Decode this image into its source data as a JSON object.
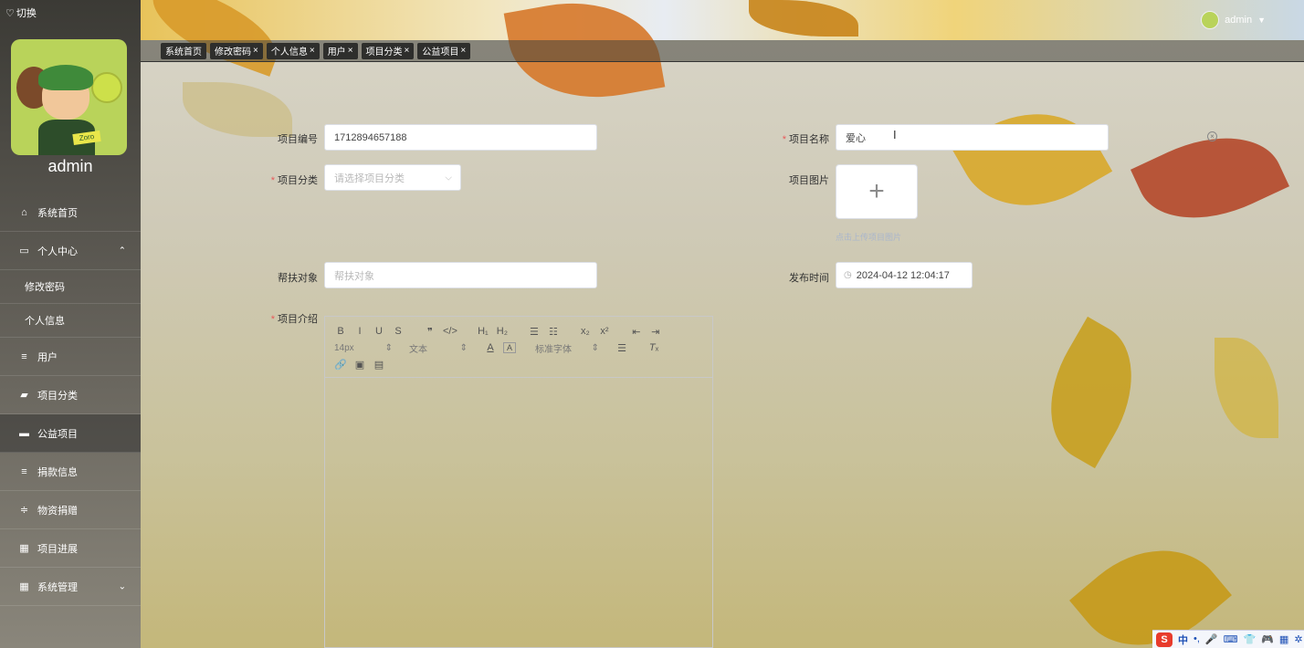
{
  "sidebar": {
    "switch_label": "切换",
    "username": "admin",
    "menu": [
      {
        "label": "系统首页",
        "icon": "home-icon",
        "glyph": "⌂"
      },
      {
        "label": "个人中心",
        "icon": "person-card-icon",
        "glyph": "▭",
        "arrow": "⌃"
      },
      {
        "label": "修改密码",
        "sub": true
      },
      {
        "label": "个人信息",
        "sub": true
      },
      {
        "label": "用户",
        "icon": "list-icon",
        "glyph": "≡"
      },
      {
        "label": "项目分类",
        "icon": "briefcase-icon",
        "glyph": "▰"
      },
      {
        "label": "公益项目",
        "icon": "ticket-icon",
        "glyph": "▬",
        "active": true
      },
      {
        "label": "捐款信息",
        "icon": "list-icon",
        "glyph": "≡"
      },
      {
        "label": "物资捐赠",
        "icon": "sliders-icon",
        "glyph": "≑"
      },
      {
        "label": "项目进展",
        "icon": "grid-icon",
        "glyph": "▦"
      },
      {
        "label": "系统管理",
        "icon": "grid-icon",
        "glyph": "▦",
        "arrow": "⌄"
      }
    ]
  },
  "header": {
    "user_name": "admin",
    "user_arrow": "▼"
  },
  "tabs": [
    {
      "label": "系统首页",
      "closable": false
    },
    {
      "label": "修改密码",
      "closable": true
    },
    {
      "label": "个人信息",
      "closable": true
    },
    {
      "label": "用户",
      "closable": true
    },
    {
      "label": "项目分类",
      "closable": true
    },
    {
      "label": "公益项目",
      "closable": true
    }
  ],
  "form": {
    "project_no": {
      "label": "项目编号",
      "value": "1712894657188"
    },
    "project_name": {
      "label": "项目名称",
      "value": "爱心"
    },
    "category": {
      "label": "项目分类",
      "placeholder": "请选择项目分类"
    },
    "image": {
      "label": "项目图片",
      "plus": "+",
      "tip": "点击上传项目图片"
    },
    "target": {
      "label": "帮扶对象",
      "placeholder": "帮扶对象"
    },
    "publish_time": {
      "label": "发布时间",
      "value": "2024-04-12 12:04:17"
    },
    "intro": {
      "label": "项目介绍"
    }
  },
  "editor": {
    "row1": [
      "B",
      "I",
      "U",
      "S",
      "❞",
      "</>",
      "H₁",
      "H₂",
      "☰",
      "☷",
      "x₂",
      "x²",
      "⇤",
      "⇥"
    ],
    "size": "14px",
    "type": "文本",
    "font": "标准字体",
    "row3": [
      "🔗",
      "▣",
      "▤"
    ]
  },
  "ime": {
    "logo": "S",
    "lang": "中",
    "items": [
      "•,",
      "🎤",
      "⌨",
      "👕",
      "🎮",
      "▦",
      "✲"
    ]
  }
}
